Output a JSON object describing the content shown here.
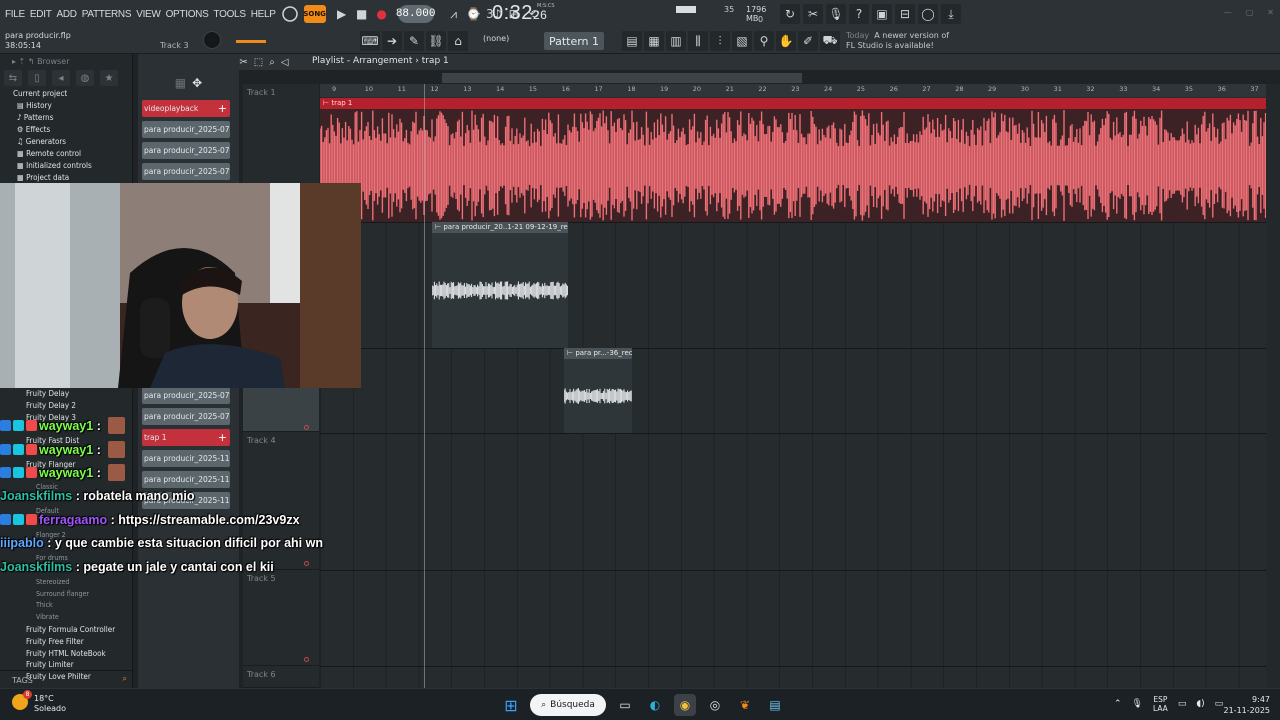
{
  "menu": [
    "FILE",
    "EDIT",
    "ADD",
    "PATTERNS",
    "VIEW",
    "OPTIONS",
    "TOOLS",
    "HELP"
  ],
  "transport": {
    "song_badge": "SONG",
    "tempo": "88.000",
    "time_main": "0:32",
    "time_sub": "26",
    "time_label": "M:S:CS"
  },
  "monitor": {
    "cpu": "35",
    "memory": "1796 MB",
    "voices": "0"
  },
  "project": {
    "file": "para producir.flp",
    "elapsed": "38:05:14",
    "hint": "Track 3"
  },
  "snap": "(none)",
  "pattern": "Pattern 1",
  "news": {
    "label": "Today",
    "line1": "A newer version of",
    "line2": "FL Studio is available!"
  },
  "browser": {
    "title": "Browser",
    "tree_root": "Current project",
    "tree": [
      "History",
      "Patterns",
      "Effects",
      "Generators",
      "Remote control",
      "Initialized controls",
      "Project data"
    ],
    "plugins": [
      {
        "label": "Fruity Delay",
        "sub": false
      },
      {
        "label": "Fruity Delay 2",
        "sub": false
      },
      {
        "label": "Fruity Delay 3",
        "sub": false
      },
      {
        "label": "",
        "sub": false
      },
      {
        "label": "Fruity Fast Dist",
        "sub": false
      },
      {
        "label": "",
        "sub": false
      },
      {
        "label": "Fruity Flanger",
        "sub": false
      },
      {
        "label": "",
        "sub": true
      },
      {
        "label": "Classic",
        "sub": true
      },
      {
        "label": "",
        "sub": true
      },
      {
        "label": "Default",
        "sub": true
      },
      {
        "label": "",
        "sub": true
      },
      {
        "label": "Flanger 2",
        "sub": true
      },
      {
        "label": "",
        "sub": true
      },
      {
        "label": "For drums",
        "sub": true
      },
      {
        "label": "",
        "sub": true
      },
      {
        "label": "Stereoized",
        "sub": true
      },
      {
        "label": "Surround flanger",
        "sub": true
      },
      {
        "label": "Thick",
        "sub": true
      },
      {
        "label": "Vibrate",
        "sub": true
      },
      {
        "label": "Fruity Formula Controller",
        "sub": false
      },
      {
        "label": "Fruity Free Filter",
        "sub": false
      },
      {
        "label": "Fruity HTML NoteBook",
        "sub": false
      },
      {
        "label": "Fruity Limiter",
        "sub": false
      },
      {
        "label": "Fruity Love Philter",
        "sub": false
      }
    ],
    "tags": "TAGS"
  },
  "channels": [
    {
      "label": "videoplayback",
      "red": true
    },
    {
      "label": "para producir_2025-07-...",
      "red": false
    },
    {
      "label": "para producir_2025-07-...",
      "red": false
    },
    {
      "label": "para producir_2025-07-...",
      "red": false
    },
    {
      "label": "para producir_2025-07-...",
      "red": false
    },
    {
      "label": "para producir_2025-07-...",
      "red": false
    },
    {
      "label": "trap 1",
      "red": true
    },
    {
      "label": "para producir_2025-11-2...",
      "red": false
    },
    {
      "label": "para producir_2025-11-2...",
      "red": false
    },
    {
      "label": "para producir_2025-11-2...",
      "red": false
    }
  ],
  "playlist": {
    "title": "Playlist - Arrangement",
    "crumb": "trap 1",
    "tracks": [
      "Track 1",
      "Track 4",
      "Track 5",
      "Track 6"
    ],
    "ruler": [
      "9",
      "10",
      "11",
      "12",
      "13",
      "14",
      "15",
      "16",
      "17",
      "18",
      "19",
      "20",
      "21",
      "22",
      "23",
      "24",
      "25",
      "26",
      "27",
      "28",
      "29",
      "30",
      "31",
      "32",
      "33",
      "34",
      "35",
      "36",
      "37"
    ],
    "clips": [
      {
        "label": "trap 1"
      },
      {
        "label": "para producir_20..1-21 09-12-19_rec"
      },
      {
        "label": "para pr...-36_rec"
      }
    ]
  },
  "chat": [
    {
      "user": "wayway1",
      "text": "",
      "color": "#7dff4a"
    },
    {
      "user": "wayway1",
      "text": "",
      "color": "#7dff4a"
    },
    {
      "user": "wayway1",
      "text": "",
      "color": "#7dff4a"
    },
    {
      "user": "Joanskfilms",
      "text": "robatela mano mio",
      "color": "#2bbfa2"
    },
    {
      "user": "ferragaamo",
      "text": "https://streamable.com/23v9zx",
      "color": "#a354ff"
    },
    {
      "user": "iiipablo",
      "text": "y que cambie esta situacion dificil por ahi wn",
      "color": "#5fa8ff"
    },
    {
      "user": "Joanskfilms",
      "text": "pegate un jale y cantai con el kii",
      "color": "#2bbfa2"
    }
  ],
  "taskbar": {
    "weather_temp": "18°C",
    "weather_desc": "Soleado",
    "search": "Búsqueda",
    "lang1": "ESP",
    "lang2": "LAA",
    "time": "9:47",
    "date": "21-11-2025"
  },
  "colors": {
    "accent": "#f08b1a",
    "trap_clip": "#f27077",
    "clip_header_red": "#b5202d"
  }
}
